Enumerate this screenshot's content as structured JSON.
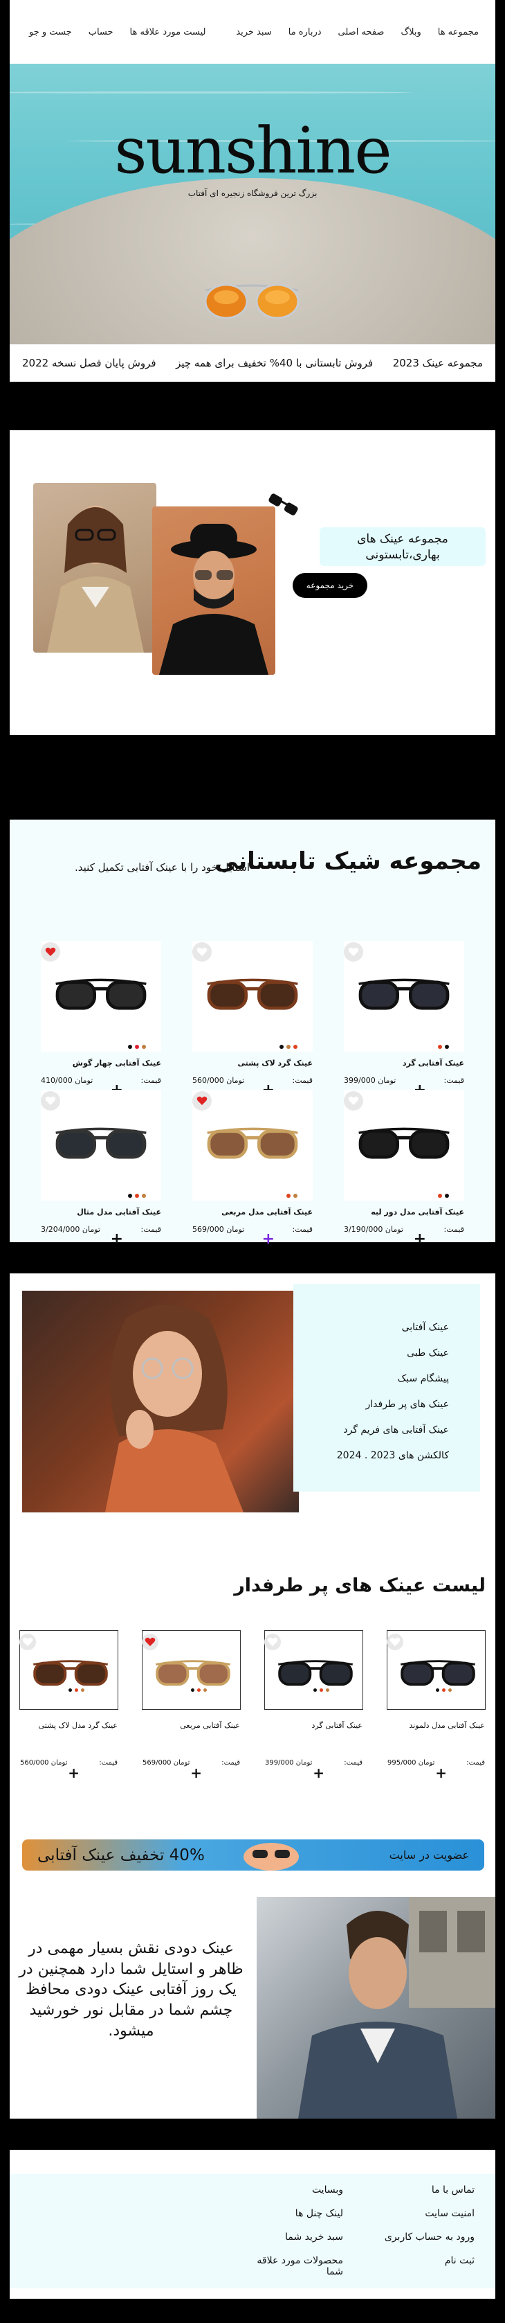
{
  "nav": {
    "items": [
      "مجموعه ها",
      "وبلاگ",
      "صفحه اصلی",
      "درباره ما",
      "سبد خرید",
      "لیست مورد علاقه ها",
      "حساب",
      "جست و جو"
    ]
  },
  "hero": {
    "logo": "sunshine",
    "tagline": "بزرگ ترین فروشگاه زنجیره ای آفتاب"
  },
  "ticker": {
    "items": [
      "مجموعه عینک 2023",
      "فروش تابستانی با 40% تخفیف برای همه چیز",
      "فروش پایان فصل نسخه 2022"
    ]
  },
  "promo": {
    "title": "مجموعه عینک های بهاری،تابستونی",
    "button": "خرید مجموعه"
  },
  "shop": {
    "title": "مجموعه شیک تابستانی",
    "subtitle": "استایل خود را با عینک آفتابی تکمیل کنید.",
    "price_label": "قیمت:",
    "products": [
      {
        "name": "عینک آفتابی گرد",
        "price": "399/000",
        "currency": "تومان",
        "liked": false,
        "frame": "#111",
        "lens": "#2b2e38",
        "dots": [
          "#e0421f",
          "#111"
        ]
      },
      {
        "name": "عینک گرد لاک پشتی",
        "price": "560/000",
        "currency": "تومان",
        "liked": false,
        "frame": "#7a3b1c",
        "lens": "#4a2a18",
        "dots": [
          "#111",
          "#c08040",
          "#e0421f"
        ]
      },
      {
        "name": "عینک آفتابی چهار گوش",
        "price": "410/000",
        "currency": "تومان",
        "liked": true,
        "frame": "#111",
        "lens": "#2a2a2a",
        "dots": [
          "#111",
          "#d23",
          "#c08040"
        ]
      },
      {
        "name": "عینک آفتابی مدل دور لبه",
        "price": "3/190/000",
        "currency": "تومان",
        "liked": false,
        "frame": "#111",
        "lens": "#1c1c1c",
        "dots": [
          "#e0421f",
          "#111"
        ]
      },
      {
        "name": "عینک آفتابی مدل مربعی",
        "price": "569/000",
        "currency": "تومان",
        "liked": true,
        "frame": "#c8a060",
        "lens": "#8a5a3c",
        "dots": [
          "#e0421f",
          "#c08040"
        ]
      },
      {
        "name": "عینک آفتابی مدل مثال",
        "price": "3/204/000",
        "currency": "تومان",
        "liked": false,
        "frame": "#333",
        "lens": "#2a2f35",
        "dots": [
          "#111",
          "#e0421f",
          "#c08040"
        ]
      }
    ]
  },
  "feature": {
    "menu": [
      "عینک آفتابی",
      "عینک طبی",
      "پیشگام سبک",
      "عینک های پر طرفدار",
      "عینک آفتابی های فریم گرد",
      "کالکشن های 2023 . 2024"
    ]
  },
  "popular": {
    "title": "لیست عینک های پر طرفدار",
    "price_label": "قیمت:",
    "products": [
      {
        "name": "عینک آفتابی مدل دلموند",
        "price": "995/000",
        "currency": "تومان",
        "liked": false,
        "frame": "#111",
        "lens": "#2b2e38"
      },
      {
        "name": "عینک آفتابی گرد",
        "price": "399/000",
        "currency": "تومان",
        "liked": false,
        "frame": "#111",
        "lens": "#262a33"
      },
      {
        "name": "عینک آفتابی مربعی",
        "price": "569/000",
        "currency": "تومان",
        "liked": true,
        "frame": "#c8a060",
        "lens": "#a06a4c"
      },
      {
        "name": "عینک گرد مدل لاک پشتی",
        "price": "560/000",
        "currency": "تومان",
        "liked": false,
        "frame": "#7a3b1c",
        "lens": "#4a2a18"
      }
    ]
  },
  "banner": {
    "join": "عضویت در سایت",
    "discount": "40% تخفیف عینک آفتابی"
  },
  "quote": {
    "text": "عینک دودی نقش بسیار مهمی در ظاهر و استایل شما دارد همچنین در یک روز آفتابی عینک دودی محافظ چشم شما در مقابل نور خورشید میشود."
  },
  "footer": {
    "col1": [
      "تماس با ما",
      "امنیت سایت",
      "ورود به حساب کاربری",
      "ثبت نام"
    ],
    "col2": [
      "وبسایت",
      "لینک چنل ها",
      "سبد خرید شما",
      "محصولات  مورد علاقه شما"
    ]
  },
  "colors": {
    "accent_light": "#e4fbfd",
    "like_red": "#e02424",
    "black": "#000000"
  }
}
